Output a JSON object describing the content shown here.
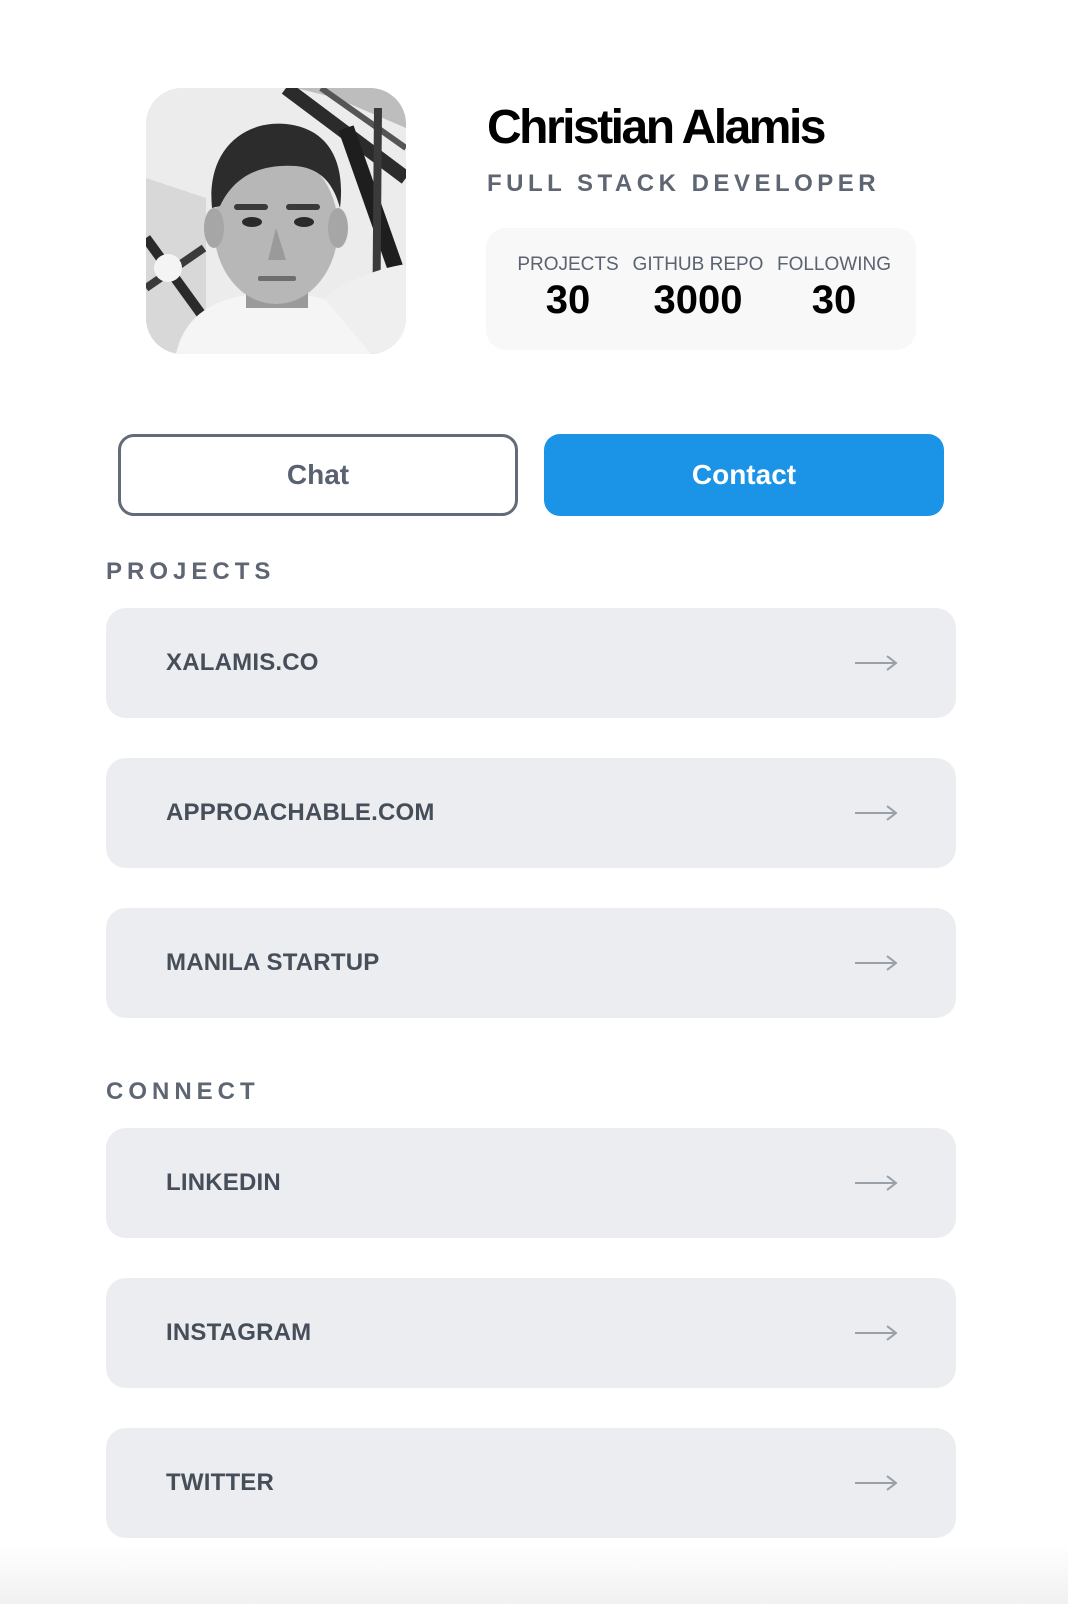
{
  "profile": {
    "name": "Christian Alamis",
    "role": "FULL STACK DEVELOPER",
    "stats": [
      {
        "label": "PROJECTS",
        "value": "30"
      },
      {
        "label": "GITHUB REPO",
        "value": "3000"
      },
      {
        "label": "FOLLOWING",
        "value": "30"
      }
    ]
  },
  "actions": {
    "chat_label": "Chat",
    "contact_label": "Contact"
  },
  "projects": {
    "title": "PROJECTS",
    "items": [
      {
        "label": "XALAMIS.CO",
        "icon": "arrow-right-icon"
      },
      {
        "label": "APPROACHABLE.COM",
        "icon": "arrow-right-icon"
      },
      {
        "label": "MANILA STARTUP",
        "icon": "arrow-right-icon"
      }
    ]
  },
  "connect": {
    "title": "CONNECT",
    "items": [
      {
        "label": "LINKEDIN",
        "icon": "arrow-right-icon"
      },
      {
        "label": "INSTAGRAM",
        "icon": "arrow-right-icon"
      },
      {
        "label": "TWITTER",
        "icon": "arrow-right-icon"
      }
    ]
  },
  "colors": {
    "accent": "#1b93e6",
    "card_bg": "#ebedf0",
    "muted_text": "#5f6673"
  }
}
